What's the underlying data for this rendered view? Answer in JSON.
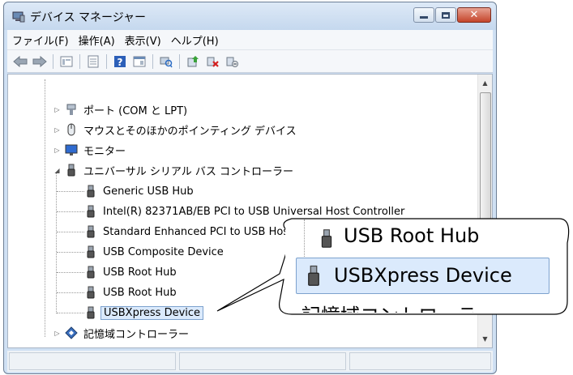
{
  "window": {
    "title": "デバイス マネージャー",
    "title_icon": "computer-manage-icon",
    "buttons": [
      "minimize",
      "maximize",
      "close"
    ]
  },
  "menubar": {
    "items": [
      {
        "label": "ファイル(F)"
      },
      {
        "label": "操作(A)"
      },
      {
        "label": "表示(V)"
      },
      {
        "label": "ヘルプ(H)"
      }
    ]
  },
  "toolbar": {
    "icons": [
      "back-arrow-icon",
      "forward-arrow-icon",
      "view-icon",
      "properties-icon",
      "help-icon",
      "view-details-icon",
      "scan-hardware-icon",
      "update-driver-icon",
      "uninstall-icon",
      "disable-icon"
    ]
  },
  "tree": {
    "ports": "ポート (COM と LPT)",
    "mouse": "マウスとそのほかのポインティング デバイス",
    "monitor": "モニター",
    "usb_controllers": "ユニバーサル シリアル バス コントローラー",
    "usb_children": [
      "Generic USB Hub",
      "Intel(R) 82371AB/EB PCI to USB Universal Host Controller",
      "Standard Enhanced PCI to USB Host Controller",
      "USB Composite Device",
      "USB Root Hub",
      "USB Root Hub",
      "USBXpress Device"
    ],
    "storage": "記憶域コントローラー",
    "selected_index": 6
  },
  "callout": {
    "line1": "USB Root Hub",
    "line2": "USBXpress Device",
    "line3": "記憶域コントローラー"
  },
  "colors": {
    "selection_bg": "#dbeafc",
    "selection_border": "#7da2ce",
    "close_button": "#c4452b"
  }
}
